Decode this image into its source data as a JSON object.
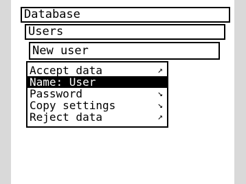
{
  "breadcrumbs": {
    "level1": "Database",
    "level2": "Users",
    "level3": "New user"
  },
  "menu": {
    "items": [
      {
        "label": "Accept data",
        "icon": "arrow-up-right-icon",
        "glyph": "↗",
        "selected": false
      },
      {
        "label": "Name: User",
        "icon": "",
        "glyph": "",
        "selected": true
      },
      {
        "label": "Password",
        "icon": "arrow-down-right-icon",
        "glyph": "↘",
        "selected": false
      },
      {
        "label": "Copy settings",
        "icon": "arrow-down-right-icon",
        "glyph": "↘",
        "selected": false
      },
      {
        "label": "Reject data",
        "icon": "arrow-up-right-icon",
        "glyph": "↗",
        "selected": false
      }
    ]
  },
  "colors": {
    "screen_bg": "#ffffff",
    "frame_bg": "#d9d9d9",
    "ink": "#000000",
    "highlight": "#000000"
  }
}
